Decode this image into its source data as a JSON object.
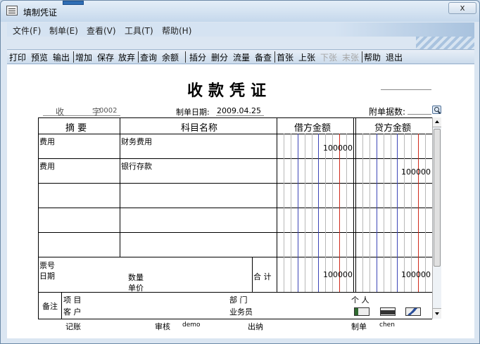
{
  "window": {
    "title": "填制凭证",
    "close_label": "x"
  },
  "menu": [
    "文件(F)",
    "制单(E)",
    "查看(V)",
    "工具(T)",
    "帮助(H)"
  ],
  "toolbar": [
    "打印",
    "预览",
    "输出",
    "增加",
    "保存",
    "放弃",
    "查询",
    "余额",
    "插分",
    "删分",
    "流量",
    "备查",
    "首张",
    "上张",
    "下张",
    "末张",
    "帮助",
    "退出"
  ],
  "voucher": {
    "title": "收款凭证",
    "word_label": "收 字",
    "number": "0002",
    "date_label": "制单日期:",
    "date": "2009.04.25",
    "attachments_label": "附单据数:"
  },
  "table": {
    "headers": {
      "summary": "摘  要",
      "account": "科目名称",
      "debit": "借方金额",
      "credit": "贷方金额"
    },
    "rows": [
      {
        "summary": "费用",
        "account": "财务费用",
        "debit": "100000",
        "credit": ""
      },
      {
        "summary": "费用",
        "account": "银行存款",
        "debit": "",
        "credit": "100000"
      },
      {
        "summary": "",
        "account": "",
        "debit": "",
        "credit": ""
      },
      {
        "summary": "",
        "account": "",
        "debit": "",
        "credit": ""
      },
      {
        "summary": "",
        "account": "",
        "debit": "",
        "credit": ""
      }
    ],
    "ticket_label": "票号",
    "date_label": "日期",
    "qty_label": "数量",
    "price_label": "单价",
    "total_label": "合 计",
    "total_debit": "100000",
    "total_credit": "100000"
  },
  "notes": {
    "label": "备注",
    "project_label": "项  目",
    "dept_label": "部  门",
    "person_label": "个  人",
    "customer_label": "客  户",
    "salesman_label": "业务员"
  },
  "footer": {
    "bookkeeper_label": "记账",
    "reviewer_label": "审核",
    "reviewer": "demo",
    "cashier_label": "出纳",
    "maker_label": "制单",
    "maker": "chen"
  },
  "icons": [
    "window-icon",
    "close-icon",
    "search-icon",
    "scroll-up-icon",
    "scroll-down-icon",
    "note-icon-1",
    "note-icon-2",
    "note-icon-3"
  ]
}
